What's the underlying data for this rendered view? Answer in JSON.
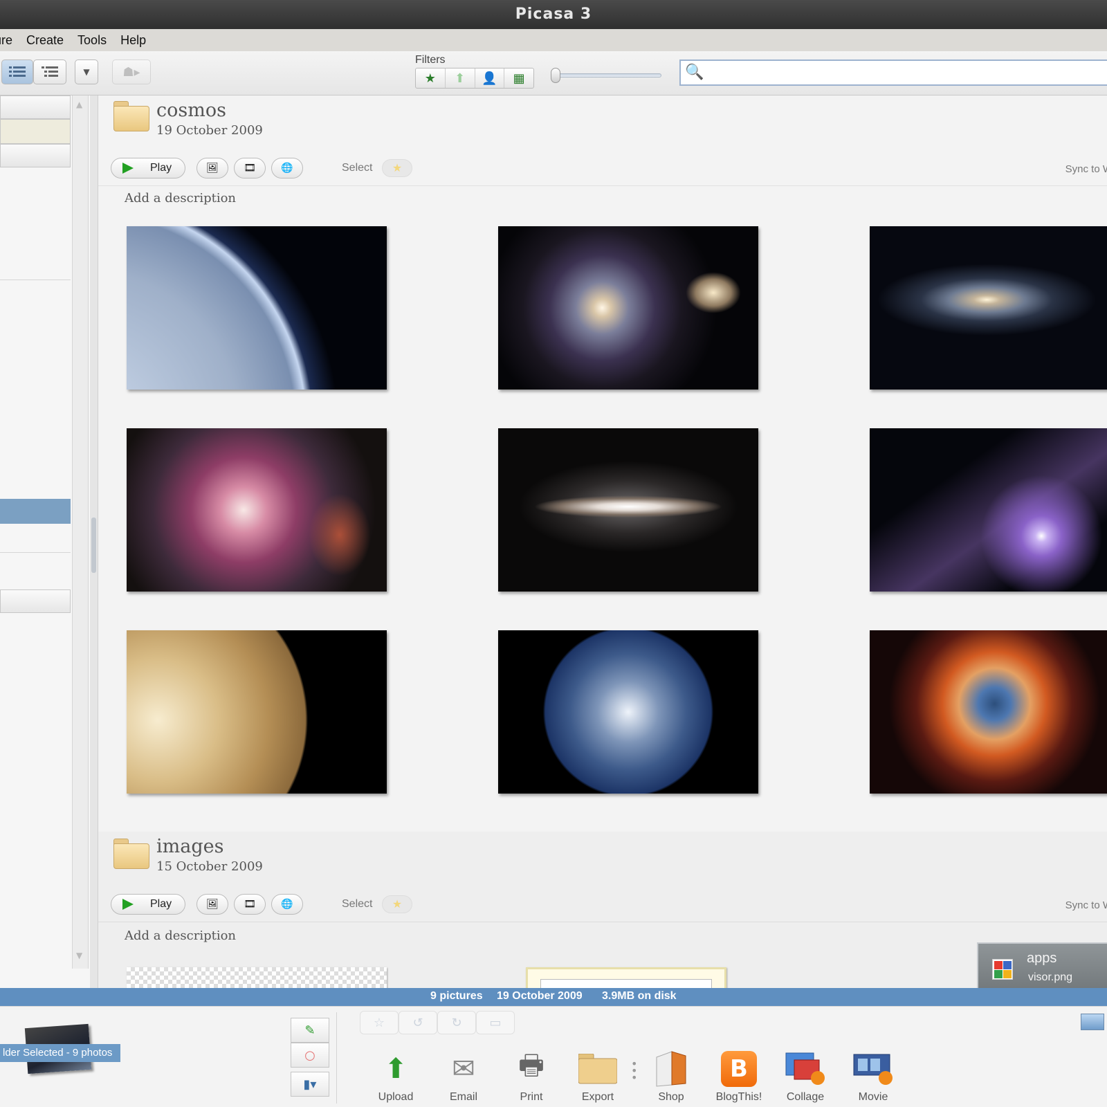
{
  "window": {
    "title": "Picasa 3"
  },
  "menu": {
    "items": [
      "ure",
      "Create",
      "Tools",
      "Help"
    ]
  },
  "toolbar": {
    "filters_label": "Filters",
    "search_placeholder": ""
  },
  "folders": [
    {
      "name": "cosmos",
      "date": "19 October 2009",
      "play_label": "Play",
      "select_label": "Select",
      "sync_label": "Sync to W",
      "description_placeholder": "Add a description",
      "photos": [
        "earth-limb",
        "whirlpool-galaxy",
        "spiral-galaxy",
        "orion-nebula",
        "sombrero-galaxy",
        "comet",
        "jupiter",
        "earth",
        "helix-nebula"
      ]
    },
    {
      "name": "images",
      "date": "15 October 2009",
      "play_label": "Play",
      "select_label": "Select",
      "sync_label": "Sync to W",
      "description_placeholder": "Add a description"
    }
  ],
  "notification": {
    "title": "apps",
    "file": "visor.png"
  },
  "statusbar": {
    "count": "9 pictures",
    "date": "19 October 2009",
    "size": "3.9MB on disk"
  },
  "tray": {
    "selection_label": "lder Selected - 9 photos",
    "actions": [
      "Upload",
      "Email",
      "Print",
      "Export",
      "Shop",
      "BlogThis!",
      "Collage",
      "Movie"
    ]
  }
}
